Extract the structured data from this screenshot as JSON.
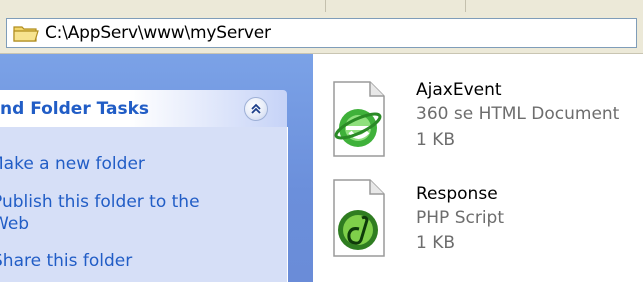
{
  "address_bar": {
    "path": "C:\\AppServ\\www\\myServer",
    "icon": "folder-icon"
  },
  "task_pane": {
    "header_title": "nd Folder Tasks",
    "collapse_icon": "double-chevron-up-icon",
    "links": [
      {
        "label": "Make a new folder"
      },
      {
        "label": "Publish this folder to the Web"
      },
      {
        "label": "Share this folder"
      }
    ]
  },
  "files": [
    {
      "name": "AjaxEvent",
      "type": "360 se HTML Document",
      "size": "1 KB",
      "icon": "html-document-icon"
    },
    {
      "name": "Response",
      "type": "PHP Script",
      "size": "1 KB",
      "icon": "php-script-icon"
    }
  ]
}
